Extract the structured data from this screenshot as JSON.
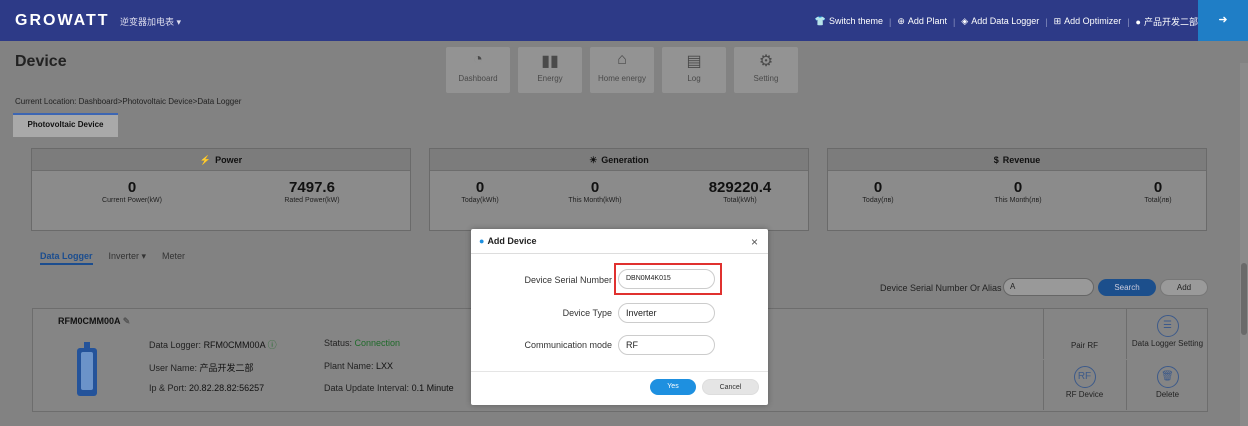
{
  "app": {
    "logo": "GROWATT",
    "plant_selector": "逆变器加电表 ▾"
  },
  "topnav": {
    "switch_theme": "Switch theme",
    "add_plant": "Add Plant",
    "add_data_logger": "Add Data Logger",
    "add_optimizer": "Add Optimizer",
    "user": "产品开发二部"
  },
  "page": {
    "title": "Device",
    "breadcrumb": "Current Location: Dashboard>Photovoltaic Device>Data Logger",
    "tab": "Photovoltaic Device"
  },
  "modules": [
    {
      "label": "Dashboard",
      "icon": "gauge-icon"
    },
    {
      "label": "Energy",
      "icon": "bar-chart-icon"
    },
    {
      "label": "Home energy",
      "icon": "home-icon"
    },
    {
      "label": "Log",
      "icon": "log-icon"
    },
    {
      "label": "Setting",
      "icon": "gear-icon"
    }
  ],
  "cards": {
    "power": {
      "title": "Power",
      "s1_val": "0",
      "s1_lbl": "Current Power(kW)",
      "s2_val": "7497.6",
      "s2_lbl": "Rated Power(kW)"
    },
    "generation": {
      "title": "Generation",
      "s1_val": "0",
      "s1_lbl": "Today(kWh)",
      "s2_val": "0",
      "s2_lbl": "This Month(kWh)",
      "s3_val": "829220.4",
      "s3_lbl": "Total(kWh)"
    },
    "revenue": {
      "title": "Revenue",
      "s1_val": "0",
      "s1_lbl": "Today(лв)",
      "s2_val": "0",
      "s2_lbl": "This Month(лв)",
      "s3_val": "0",
      "s3_lbl": "Total(лв)"
    }
  },
  "subtabs": {
    "data_logger": "Data Logger",
    "inverter": "Inverter ▾",
    "meter": "Meter"
  },
  "search": {
    "label": "Device Serial Number Or Alias",
    "value": "A",
    "search_btn": "Search",
    "add_btn": "Add"
  },
  "device": {
    "name": "RFM0CMM00A",
    "logger_lbl": "Data Logger:",
    "logger_val": "RFM0CMM00A",
    "user_lbl": "User Name:",
    "user_val": "产品开发二部",
    "ip_lbl": "Ip & Port:",
    "ip_val": "20.82.28.82:56257",
    "status_lbl": "Status:",
    "status_val": "Connection",
    "plant_lbl": "Plant Name:",
    "plant_val": "LXX",
    "interval_lbl": "Data Update Interval:",
    "interval_val": "0.1 Minute"
  },
  "actions": {
    "pair_rf": "Pair RF",
    "logger_setting": "Data Logger Setting",
    "rf_device": "RF Device",
    "delete": "Delete",
    "rf_icon_text": "RF"
  },
  "dialog": {
    "title": "Add Device",
    "serial_lbl": "Device Serial Number",
    "serial_val": "DBN0M4K015",
    "type_lbl": "Device Type",
    "type_val": "Inverter",
    "mode_lbl": "Communication mode",
    "mode_val": "RF",
    "yes": "Yes",
    "cancel": "Cancel"
  },
  "colors": {
    "topbar": "#2d3a87",
    "accent": "#1e90e0",
    "highlight": "#e0312f"
  }
}
